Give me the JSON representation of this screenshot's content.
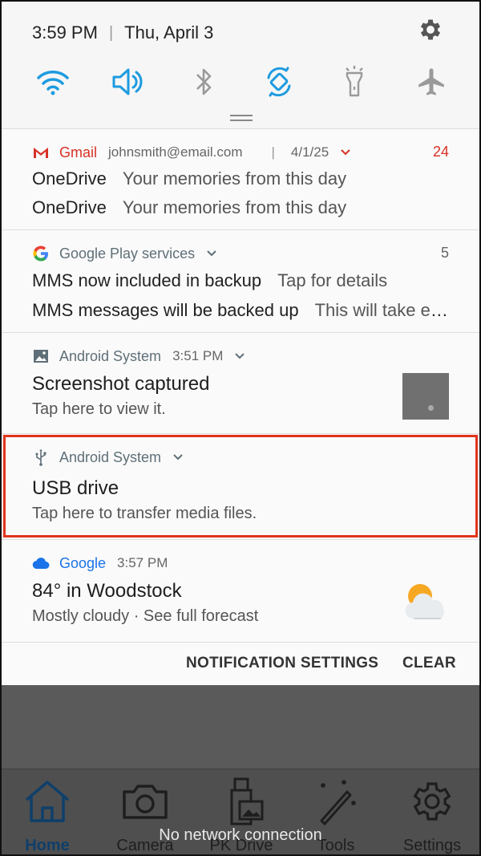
{
  "status": {
    "time": "3:59 PM",
    "date": "Thu, April 3"
  },
  "quick_toggles": [
    "wifi-icon",
    "volume-icon",
    "bluetooth-icon",
    "auto-rotate-icon",
    "flashlight-icon",
    "airplane-mode-icon"
  ],
  "notifications": {
    "gmail": {
      "app": "Gmail",
      "account": "johnsmith@email.com",
      "date": "4/1/25",
      "count": "24",
      "lines": [
        {
          "title": "OneDrive",
          "text": "Your memories from this day"
        },
        {
          "title": "OneDrive",
          "text": "Your memories from this day"
        }
      ]
    },
    "play_services": {
      "app": "Google Play services",
      "count": "5",
      "lines": [
        {
          "title": "MMS now included in backup",
          "text": "Tap for details"
        },
        {
          "title": "MMS messages will be backed up",
          "text": "This will take eff…"
        }
      ]
    },
    "screenshot": {
      "app": "Android System",
      "time": "3:51 PM",
      "title": "Screenshot captured",
      "desc": "Tap here to view it."
    },
    "usb": {
      "app": "Android System",
      "title": "USB drive",
      "desc": "Tap here to transfer media files."
    },
    "weather": {
      "app": "Google",
      "time": "3:57 PM",
      "title": "84° in Woodstock",
      "desc": "Mostly cloudy · See full forecast"
    }
  },
  "actions": {
    "settings": "NOTIFICATION SETTINGS",
    "clear": "CLEAR"
  },
  "bottom_tabs": [
    "Home",
    "Camera",
    "PK Drive",
    "Tools",
    "Settings"
  ],
  "toast": "No network connection",
  "colors": {
    "accent_blue": "#1e9be0",
    "gmail_red": "#d93025",
    "highlight": "#e0341c"
  }
}
